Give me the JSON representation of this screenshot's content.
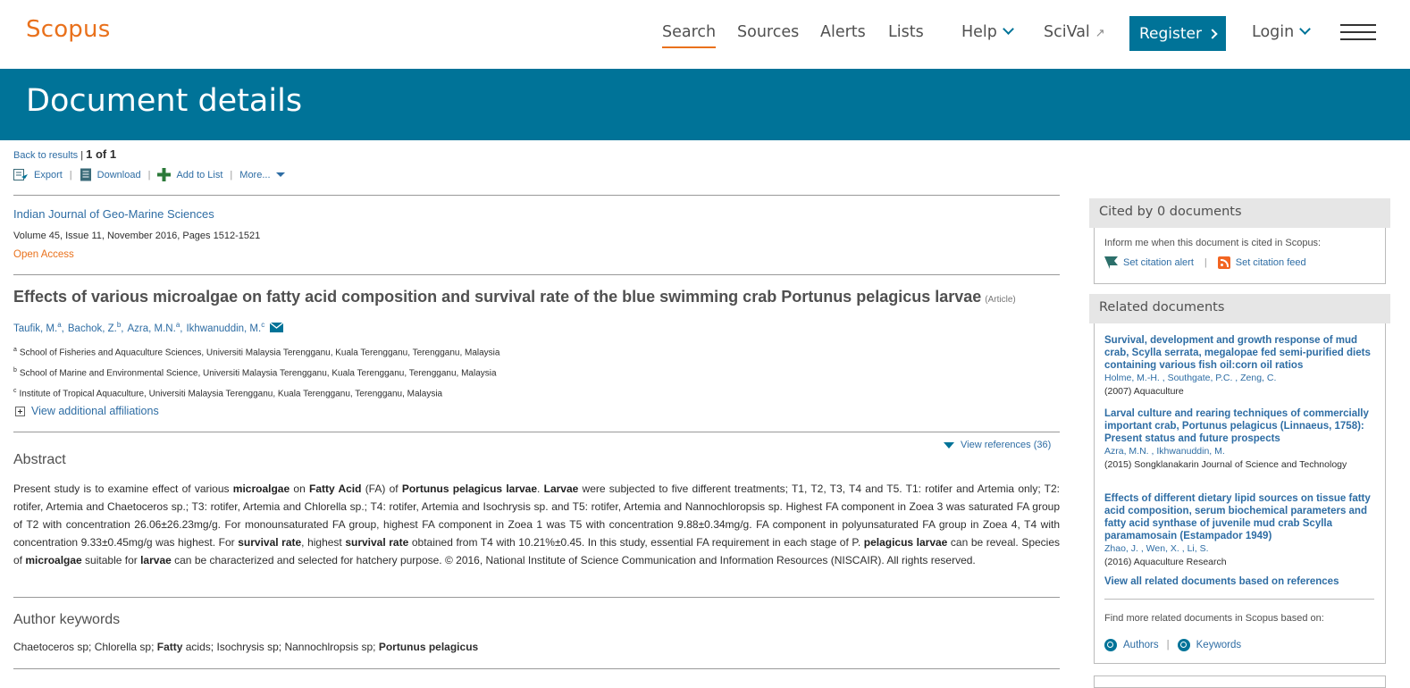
{
  "nav": {
    "logo": "Scopus",
    "links": [
      "Search",
      "Sources",
      "Alerts",
      "Lists"
    ],
    "help": "Help",
    "scival": "SciVal",
    "scival_icon": "↗",
    "register": "Register",
    "login": "Login"
  },
  "banner": {
    "title": "Document details"
  },
  "toolbar": {
    "back": "Back to results",
    "separator": "|",
    "position": "1 of 1",
    "export": "Export",
    "download": "Download",
    "add_to_list": "Add to List",
    "more": "More..."
  },
  "doc": {
    "journal": "Indian Journal of Geo-Marine Sciences",
    "volume": "Volume 45, Issue 11, November 2016, Pages 1512-1521",
    "open_access": "Open Access",
    "title": "Effects of various microalgae on fatty acid composition and survival rate of the blue swimming crab Portunus pelagicus larvae",
    "type": "(Article)",
    "authors": [
      {
        "name": "Taufik, M.",
        "sup": "a"
      },
      {
        "name": "Bachok, Z.",
        "sup": "b"
      },
      {
        "name": "Azra, M.N.",
        "sup": "a"
      },
      {
        "name": "Ikhwanuddin, M.",
        "sup": "c"
      }
    ],
    "affiliations": [
      {
        "sup": "a",
        "text": "School of Fisheries and Aquaculture Sciences, Universiti Malaysia Terengganu, Kuala Terengganu, Terengganu, Malaysia"
      },
      {
        "sup": "b",
        "text": "School of Marine and Environmental Science, Universiti Malaysia Terengganu, Kuala Terengganu, Terengganu, Malaysia"
      },
      {
        "sup": "c",
        "text": "Institute of Tropical Aquaculture, Universiti Malaysia Terengganu, Kuala Terengganu, Terengganu, Malaysia"
      }
    ],
    "view_affiliations": "View additional affiliations",
    "view_references": "View references (36)",
    "abstract_heading": "Abstract",
    "abstract_parts": [
      {
        "t": "Present study is to examine effect of various ",
        "b": false
      },
      {
        "t": "microalgae",
        "b": true
      },
      {
        "t": " on ",
        "b": false
      },
      {
        "t": "Fatty Acid",
        "b": true
      },
      {
        "t": " (FA) of ",
        "b": false
      },
      {
        "t": "Portunus pelagicus larvae",
        "b": true
      },
      {
        "t": ". ",
        "b": false
      },
      {
        "t": "Larvae",
        "b": true
      },
      {
        "t": " were subjected to five different treatments; T1, T2, T3, T4 and T5. T1: rotifer and Artemia only; T2: rotifer, Artemia and Chaetoceros sp.; T3: rotifer, Artemia and Chlorella sp.; T4: rotifer, Artemia and Isochrysis sp. and T5: rotifer, Artemia and Nannochloropsis sp. Highest FA component in Zoea 3 was saturated FA group of T2 with concentration 26.06±26.23mg/g. For monounsaturated FA group, highest FA component in Zoea 1 was T5 with concentration 9.88±0.34mg/g. FA component in polyunsaturated FA group in Zoea 4, T4 with concentration 9.33±0.45mg/g was highest. For ",
        "b": false
      },
      {
        "t": "survival rate",
        "b": true
      },
      {
        "t": ", highest ",
        "b": false
      },
      {
        "t": "survival rate",
        "b": true
      },
      {
        "t": " obtained from T4 with 10.21%±0.45. In this study, essential FA requirement in each stage of P. ",
        "b": false
      },
      {
        "t": "pelagicus larvae",
        "b": true
      },
      {
        "t": " can be reveal. Species of ",
        "b": false
      },
      {
        "t": "microalgae",
        "b": true
      },
      {
        "t": " suitable for ",
        "b": false
      },
      {
        "t": "larvae",
        "b": true
      },
      {
        "t": " can be characterized and selected for hatchery purpose. © 2016, National Institute of Science Communication and Information Resources (NISCAIR). All rights reserved.",
        "b": false
      }
    ],
    "keywords_heading": "Author keywords",
    "keyword_parts": [
      {
        "t": "Chaetoceros sp; Chlorella sp; ",
        "b": false
      },
      {
        "t": "Fatty",
        "b": true
      },
      {
        "t": " acids; Isochrysis sp; Nannochlropsis sp; ",
        "b": false
      },
      {
        "t": "Portunus pelagicus",
        "b": true
      }
    ]
  },
  "sidebar": {
    "cited_heading": "Cited by 0 documents",
    "inform": "Inform me when this document is cited in Scopus:",
    "set_alert": "Set citation alert",
    "set_feed": "Set citation feed",
    "related_heading": "Related documents",
    "related": [
      {
        "title": "Survival, development and growth response of mud crab, Scylla serrata, megalopae fed semi-purified diets containing various fish oil:corn oil ratios",
        "authors": "Holme, M.-H. , Southgate, P.C. , Zeng, C.",
        "year": "(2007)",
        "source": "Aquaculture"
      },
      {
        "title": "Larval culture and rearing techniques of commercially important crab, Portunus pelagicus (Linnaeus, 1758): Present status and future prospects",
        "authors": "Azra, M.N. , Ikhwanuddin, M.",
        "year": "(2015)",
        "source": "Songklanakarin Journal of Science and Technology"
      },
      {
        "title": "Effects of different dietary lipid sources on tissue fatty acid composition, serum biochemical parameters and fatty acid synthase of juvenile mud crab Scylla paramamosain (Estampador 1949)",
        "authors": "Zhao, J. , Wen, X. , Li, S.",
        "year": "(2016)",
        "source": "Aquaculture Research"
      }
    ],
    "view_all": "View all related documents based on references",
    "find_more": "Find more related documents in Scopus based on:",
    "find_authors": "Authors",
    "find_keywords": "Keywords"
  },
  "colors": {
    "brand_orange": "#e9711c",
    "brand_blue": "#007398",
    "link": "#2e6da4"
  }
}
